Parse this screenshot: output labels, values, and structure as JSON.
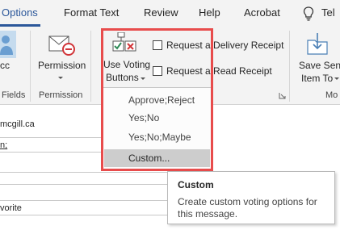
{
  "tabs": [
    {
      "label": "Options",
      "active": true
    },
    {
      "label": "Format Text"
    },
    {
      "label": "Review"
    },
    {
      "label": "Help"
    },
    {
      "label": "Acrobat"
    },
    {
      "label": "Tel"
    }
  ],
  "tell_me_icon": "lightbulb-icon",
  "ribbon": {
    "bcc_label": "cc",
    "fields_group_label": "Fields",
    "permission_label": "Permission",
    "permission_group_label": "Permission",
    "voting_line1": "Use Voting",
    "voting_line2": "Buttons",
    "delivery_receipt_label": "Request a Delivery Receipt",
    "read_receipt_label": "Request a Read Receipt",
    "save_sent_line1": "Save Sent",
    "save_sent_line2": "Item To",
    "more_group_label": "Mo"
  },
  "message": {
    "from_fragment": "mcgill.ca",
    "to_fragment": "n;",
    "subject_fragment": "vorite"
  },
  "voting_menu": {
    "items": [
      "Approve;Reject",
      "Yes;No",
      "Yes;No;Maybe",
      "Custom..."
    ],
    "hovered_index": 3
  },
  "tooltip": {
    "title": "Custom",
    "body": "Create custom voting options for this message."
  },
  "colors": {
    "accent": "#2b579a",
    "highlight_frame": "#e84c4c",
    "ribbon_bg": "#f3f3f3"
  }
}
